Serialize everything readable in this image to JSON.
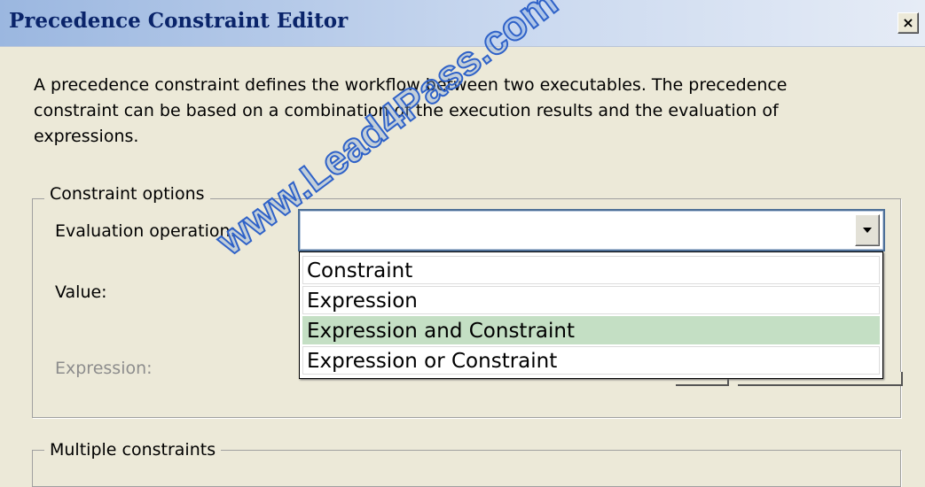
{
  "window": {
    "title": "Precedence Constraint Editor",
    "close_glyph": "×",
    "description": "A precedence constraint defines the workflow between two executables. The precedence constraint can be based on a combination of the execution results and the evaluation of expressions."
  },
  "constraint_options": {
    "legend": "Constraint options",
    "evaluation_label": "Evaluation operation:",
    "evaluation_value": "",
    "value_label": "Value:",
    "expression_label": "Expression:",
    "dropdown_options": [
      "Constraint",
      "Expression",
      "Expression and Constraint",
      "Expression or Constraint"
    ],
    "highlighted_option": "Expression and Constraint"
  },
  "multiple_constraints": {
    "legend": "Multiple constraints"
  },
  "watermark": "www.Lead4Pass.com",
  "colors": {
    "title_text": "#0a246a",
    "highlight": "#c4dfc4",
    "disabled_text": "#8d8d8d",
    "watermark": "#2f62c8"
  }
}
